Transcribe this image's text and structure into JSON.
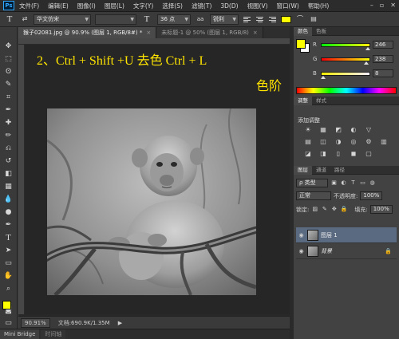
{
  "app": {
    "logo": "Ps"
  },
  "menubar": {
    "items": [
      "文件(F)",
      "编辑(E)",
      "图像(I)",
      "图层(L)",
      "文字(Y)",
      "选择(S)",
      "滤镜(T)",
      "3D(D)",
      "视图(V)",
      "窗口(W)",
      "帮助(H)"
    ],
    "window_controls": {
      "minimize": "–",
      "restore": "▫",
      "close": "✕"
    }
  },
  "options_bar": {
    "tool_glyph": "T",
    "orient_glyph": "⇄",
    "font_family": "华文仿宋",
    "font_style": "",
    "size_glyph": "T",
    "font_size": "36 点",
    "aa_glyph": "aa",
    "antialias": "锐利",
    "text_color": "#ffff00"
  },
  "toolbox": {
    "tools": [
      "move-tool",
      "marquee-tool",
      "lasso-tool",
      "quick-select-tool",
      "crop-tool",
      "eyedropper-tool",
      "healing-tool",
      "brush-tool",
      "clone-stamp-tool",
      "history-brush-tool",
      "eraser-tool",
      "gradient-tool",
      "blur-tool",
      "dodge-tool",
      "pen-tool",
      "type-tool",
      "path-select-tool",
      "shape-tool",
      "hand-tool",
      "zoom-tool"
    ],
    "tool_glyphs": [
      "✥",
      "⬚",
      "ʘ",
      "✎",
      "⌗",
      "✒",
      "✚",
      "✏",
      "⎌",
      "↺",
      "◧",
      "▦",
      "💧",
      "●",
      "✒",
      "T",
      "➤",
      "▭",
      "✋",
      "⌕"
    ],
    "foreground": "#ffff00",
    "background": "#ffffff"
  },
  "document": {
    "tabs": [
      {
        "label": "猴子02081.jpg @ 90.9% (图层 1, RGB/8#) *",
        "active": true
      },
      {
        "label": "未标题-1 @ 50% (图层 1, RGB/8)",
        "active": false
      }
    ],
    "tab_close": "×",
    "annotation_line1": "2、Ctrl + Shift +U   去色      Ctrl + L",
    "annotation_line2": "色阶",
    "annotation_color": "#ffe400"
  },
  "status": {
    "zoom": "90.91%",
    "doc_info": "文档:690.9K/1.35M",
    "nav_glyph": "▶"
  },
  "bottom_tabs": [
    "Mini Bridge",
    "时间轴"
  ],
  "color_panel": {
    "tabs": [
      "颜色",
      "色板"
    ],
    "fg": "#ffff00",
    "bg": "#ffffff",
    "channels": [
      {
        "label": "R",
        "value": "246",
        "level": 0.965
      },
      {
        "label": "G",
        "value": "238",
        "level": 0.933
      },
      {
        "label": "B",
        "value": "8",
        "level": 0.031
      }
    ]
  },
  "adjustments_panel": {
    "tabs": [
      "调整",
      "样式"
    ],
    "title": "添加调整",
    "icons": [
      "☀",
      "▦",
      "◩",
      "◐",
      "▽",
      "",
      "▤",
      "◫",
      "◑",
      "◎",
      "⚙",
      "▥",
      "◪",
      "◨",
      "▯",
      "◼",
      "▢",
      ""
    ]
  },
  "layers_panel": {
    "tabs": [
      "图层",
      "通道",
      "路径"
    ],
    "filter": "ρ 类型",
    "filter_icons": [
      "▣",
      "◐",
      "T",
      "▭",
      "◍"
    ],
    "blend_mode": "正常",
    "opacity_label": "不透明度:",
    "opacity": "100%",
    "lock_label": "锁定:",
    "lock_icons": [
      "▨",
      "✎",
      "✥",
      "🔒"
    ],
    "fill_label": "填充:",
    "fill": "100%",
    "eye_glyph": "◉",
    "lock_glyph": "🔒",
    "layers": [
      {
        "name": "图层 1",
        "selected": true
      },
      {
        "name": "背景",
        "selected": false,
        "locked": true
      }
    ]
  }
}
